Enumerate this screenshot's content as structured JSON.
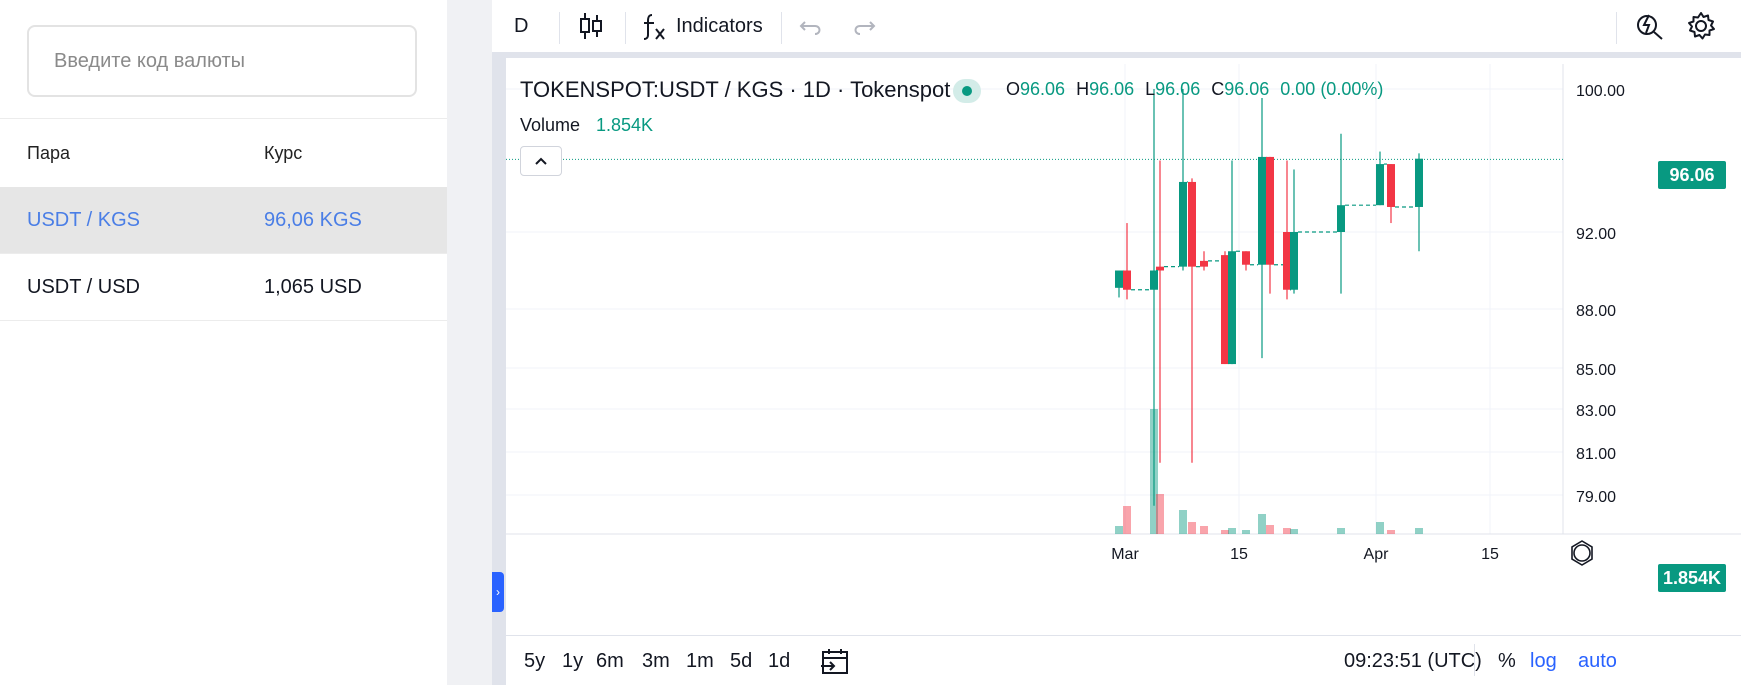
{
  "sidebar": {
    "search": {
      "placeholder": "Введите код валюты",
      "value": ""
    },
    "columns": {
      "pair": "Пара",
      "rate": "Курс"
    },
    "rows": [
      {
        "pair": "USDT / KGS",
        "rate": "96,06 KGS",
        "active": true
      },
      {
        "pair": "USDT / USD",
        "rate": "1,065 USD",
        "active": false
      }
    ]
  },
  "toolbar": {
    "interval": "D",
    "indicators_label": "Indicators",
    "icons": [
      "candles-icon",
      "fx-icon",
      "undo-icon",
      "redo-icon",
      "quick-search-icon",
      "gear-icon"
    ]
  },
  "legend": {
    "title": "TOKENSPOT:USDT / KGS · 1D · Tokenspot",
    "o_key": "O",
    "o_val": "96.06",
    "h_key": "H",
    "h_val": "96.06",
    "l_key": "L",
    "l_val": "96.06",
    "c_key": "C",
    "c_val": "96.06",
    "change": "0.00 (0.00%)",
    "volume_label": "Volume",
    "volume_value": "1.854K"
  },
  "price_axis": {
    "ticks": [
      "100.00",
      "92.00",
      "88.00",
      "85.00",
      "83.00",
      "81.00",
      "79.00"
    ],
    "last_price": "96.06",
    "last_volume": "1.854K"
  },
  "time_axis": {
    "ticks": [
      "Mar",
      "15",
      "Apr",
      "15"
    ]
  },
  "bottom": {
    "ranges": [
      "5y",
      "1y",
      "6m",
      "3m",
      "1m",
      "5d",
      "1d"
    ],
    "clock": "09:23:51 (UTC)",
    "percent_label": "%",
    "log_label": "log",
    "auto_label": "auto"
  },
  "colors": {
    "up": "#089981",
    "down": "#f23645",
    "accent": "#2962ff",
    "link": "#4a7ee6"
  },
  "chart_data": {
    "type": "candlestick",
    "title": "TOKENSPOT:USDT / KGS · 1D · Tokenspot",
    "ylim": [
      78,
      101
    ],
    "candles": [
      {
        "o": 89.1,
        "h": 89.9,
        "l": 88.6,
        "c": 90.0,
        "dir": "up"
      },
      {
        "o": 90.0,
        "h": 92.5,
        "l": 88.5,
        "c": 89.0,
        "dir": "down"
      },
      {
        "o": 89.0,
        "h": 100.0,
        "l": 78.5,
        "c": 90.0,
        "dir": "up"
      },
      {
        "o": 90.0,
        "h": 96.0,
        "l": 80.5,
        "c": 90.2,
        "dir": "down"
      },
      {
        "o": 90.2,
        "h": 100.0,
        "l": 90.0,
        "c": 94.8,
        "dir": "up"
      },
      {
        "o": 94.8,
        "h": 95.0,
        "l": 80.5,
        "c": 90.2,
        "dir": "down"
      },
      {
        "o": 90.2,
        "h": 91.0,
        "l": 90.0,
        "c": 90.5,
        "dir": "down"
      },
      {
        "o": 85.2,
        "h": 91.0,
        "l": 85.2,
        "c": 90.8,
        "dir": "down"
      },
      {
        "o": 85.2,
        "h": 96.0,
        "l": 85.2,
        "c": 91.0,
        "dir": "up"
      },
      {
        "o": 91.0,
        "h": 91.0,
        "l": 90.0,
        "c": 90.3,
        "dir": "down"
      },
      {
        "o": 90.3,
        "h": 99.5,
        "l": 85.5,
        "c": 96.2,
        "dir": "up"
      },
      {
        "o": 96.2,
        "h": 96.2,
        "l": 88.8,
        "c": 90.3,
        "dir": "down"
      },
      {
        "o": 92.0,
        "h": 96.0,
        "l": 88.5,
        "c": 89.0,
        "dir": "down"
      },
      {
        "o": 89.0,
        "h": 95.5,
        "l": 88.8,
        "c": 92.0,
        "dir": "up"
      },
      {
        "o": 92.0,
        "h": 97.5,
        "l": 88.8,
        "c": 93.5,
        "dir": "up"
      },
      {
        "o": 93.5,
        "h": 96.5,
        "l": 93.5,
        "c": 95.8,
        "dir": "up"
      },
      {
        "o": 95.8,
        "h": 95.8,
        "l": 92.5,
        "c": 93.4,
        "dir": "down"
      },
      {
        "o": 93.4,
        "h": 96.4,
        "l": 91.0,
        "c": 96.1,
        "dir": "up"
      }
    ],
    "volume_last": 1854
  }
}
